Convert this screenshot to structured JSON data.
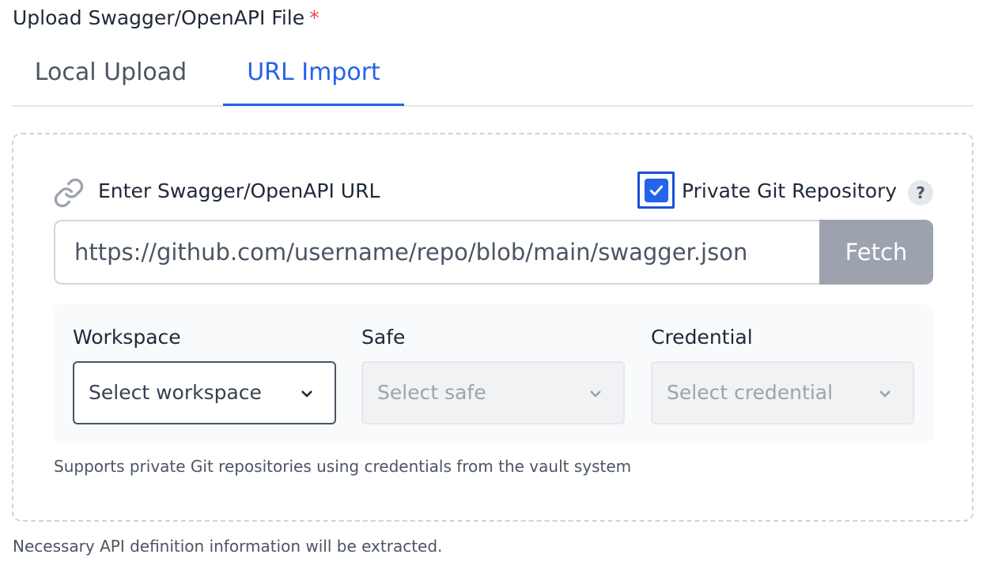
{
  "form": {
    "label": "Upload Swagger/OpenAPI File",
    "required_marker": "*"
  },
  "tabs": [
    {
      "label": "Local Upload",
      "active": false
    },
    {
      "label": "URL Import",
      "active": true
    }
  ],
  "url_section": {
    "label": "Enter Swagger/OpenAPI URL",
    "icon": "link-icon",
    "private_repo_label": "Private Git Repository",
    "private_repo_checked": true,
    "help_glyph": "?",
    "url_value": "https://github.com/username/repo/blob/main/swagger.json",
    "fetch_label": "Fetch"
  },
  "vault": {
    "workspace": {
      "label": "Workspace",
      "placeholder": "Select workspace",
      "enabled": true
    },
    "safe": {
      "label": "Safe",
      "placeholder": "Select safe",
      "enabled": false
    },
    "credential": {
      "label": "Credential",
      "placeholder": "Select credential",
      "enabled": false
    },
    "hint": "Supports private Git repositories using credentials from the vault system"
  },
  "footer_note": "Necessary API definition information will be extracted.",
  "colors": {
    "accent": "#2563eb",
    "required": "#ef4444",
    "fetch_disabled": "#9ca3af"
  }
}
